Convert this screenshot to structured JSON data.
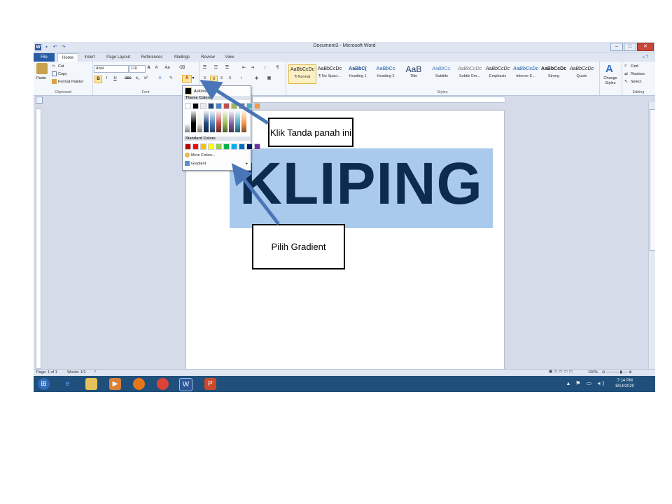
{
  "window": {
    "title": "Document3 - Microsoft Word"
  },
  "tabs": [
    "File",
    "Home",
    "Insert",
    "Page Layout",
    "References",
    "Mailings",
    "Review",
    "View"
  ],
  "clipboard": {
    "paste": "Paste",
    "cut": "Cut",
    "copy": "Copy",
    "format_painter": "Format Painter",
    "label": "Clipboard"
  },
  "font": {
    "name": "Arial",
    "size": "110",
    "label": "Font"
  },
  "paragraph": {
    "label": "Paragraph"
  },
  "styles": {
    "label": "Styles",
    "items": [
      {
        "preview": "AaBbCcDc",
        "name": "¶ Normal"
      },
      {
        "preview": "AaBbCcDc",
        "name": "¶ No Spaci..."
      },
      {
        "preview": "AaBbC(",
        "name": "Heading 1"
      },
      {
        "preview": "AaBbCc",
        "name": "Heading 2"
      },
      {
        "preview": "AaB",
        "name": "Title"
      },
      {
        "preview": "AaBbCc.",
        "name": "Subtitle"
      },
      {
        "preview": "AaBbCcDc",
        "name": "Subtle Em..."
      },
      {
        "preview": "AaBbCcDc",
        "name": "Emphasis"
      },
      {
        "preview": "AaBbCcDc",
        "name": "Intense E..."
      },
      {
        "preview": "AaBbCcDc",
        "name": "Strong"
      },
      {
        "preview": "AaBbCcDc",
        "name": "Quote"
      }
    ],
    "change_styles": "Change Styles"
  },
  "editing": {
    "find": "Find",
    "replace": "Replace",
    "select": "Select",
    "label": "Editing"
  },
  "document": {
    "text": "KLIPING"
  },
  "dropdown": {
    "automatic": "Automatic",
    "theme_colors": "Theme Colors",
    "standard_colors": "Standard Colors",
    "more_colors": "More Colors...",
    "gradient": "Gradient"
  },
  "status": {
    "page": "Page: 1 of 1",
    "words": "Words: 1/1",
    "zoom": "100%"
  },
  "taskbar": {
    "time": "7:14 PM",
    "date": "8/14/2020"
  },
  "callouts": {
    "click_arrow": "Klik Tanda panah ini",
    "choose_gradient": "Pilih Gradient"
  },
  "colors": {
    "theme_top": [
      "#ffffff",
      "#000000",
      "#eeece1",
      "#1f497d",
      "#4f81bd",
      "#c0504d",
      "#9bbb59",
      "#8064a2",
      "#4bacc6",
      "#f79646"
    ],
    "standard": [
      "#c00000",
      "#ff0000",
      "#ffc000",
      "#ffff00",
      "#92d050",
      "#00b050",
      "#00b0f0",
      "#0070c0",
      "#002060",
      "#7030a0"
    ],
    "highlight": "#a9caec",
    "text": "#0d2b4f"
  }
}
